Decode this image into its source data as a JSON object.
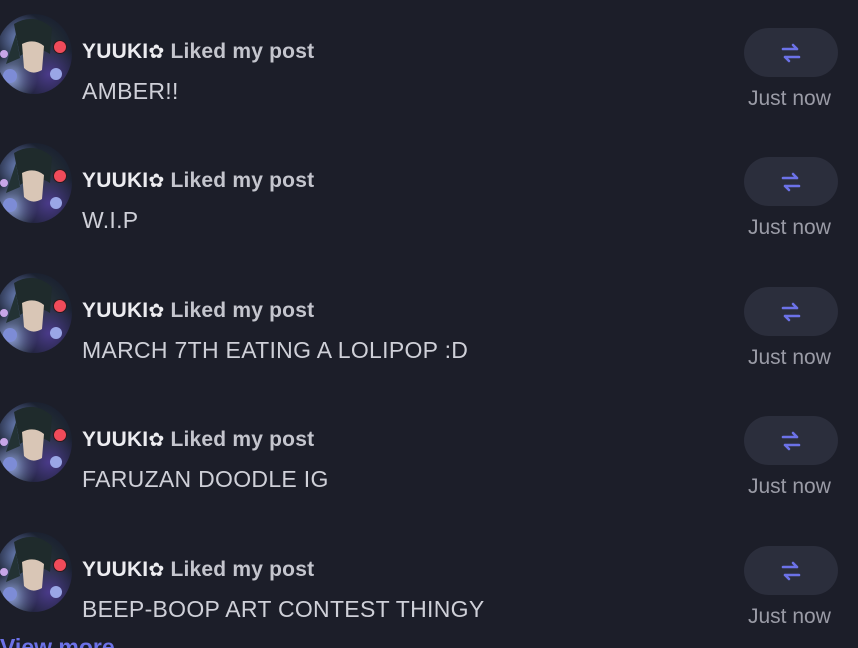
{
  "notifications": [
    {
      "username": "YUUKI",
      "username_symbol": "✿",
      "action": "Liked my post",
      "post_title": "AMBER!!",
      "time": "Just now",
      "icon": "swap-arrows-icon"
    },
    {
      "username": "YUUKI",
      "username_symbol": "✿",
      "action": "Liked my post",
      "post_title": "W.I.P",
      "time": "Just now",
      "icon": "swap-arrows-icon"
    },
    {
      "username": "YUUKI",
      "username_symbol": "✿",
      "action": "Liked my post",
      "post_title": "MARCH 7TH EATING A LOLIPOP :D",
      "time": "Just now",
      "icon": "swap-arrows-icon"
    },
    {
      "username": "YUUKI",
      "username_symbol": "✿",
      "action": "Liked my post",
      "post_title": "FARUZAN DOODLE IG",
      "time": "Just now",
      "icon": "swap-arrows-icon"
    },
    {
      "username": "YUUKI",
      "username_symbol": "✿",
      "action": "Liked my post",
      "post_title": "BEEP-BOOP ART CONTEST THINGY",
      "time": "Just now",
      "icon": "swap-arrows-icon"
    }
  ],
  "view_more_label": "View more",
  "colors": {
    "background": "#1c1e29",
    "button_bg": "#2b2e3c",
    "accent": "#6c72e8",
    "status_dot": "#f04b5a"
  }
}
